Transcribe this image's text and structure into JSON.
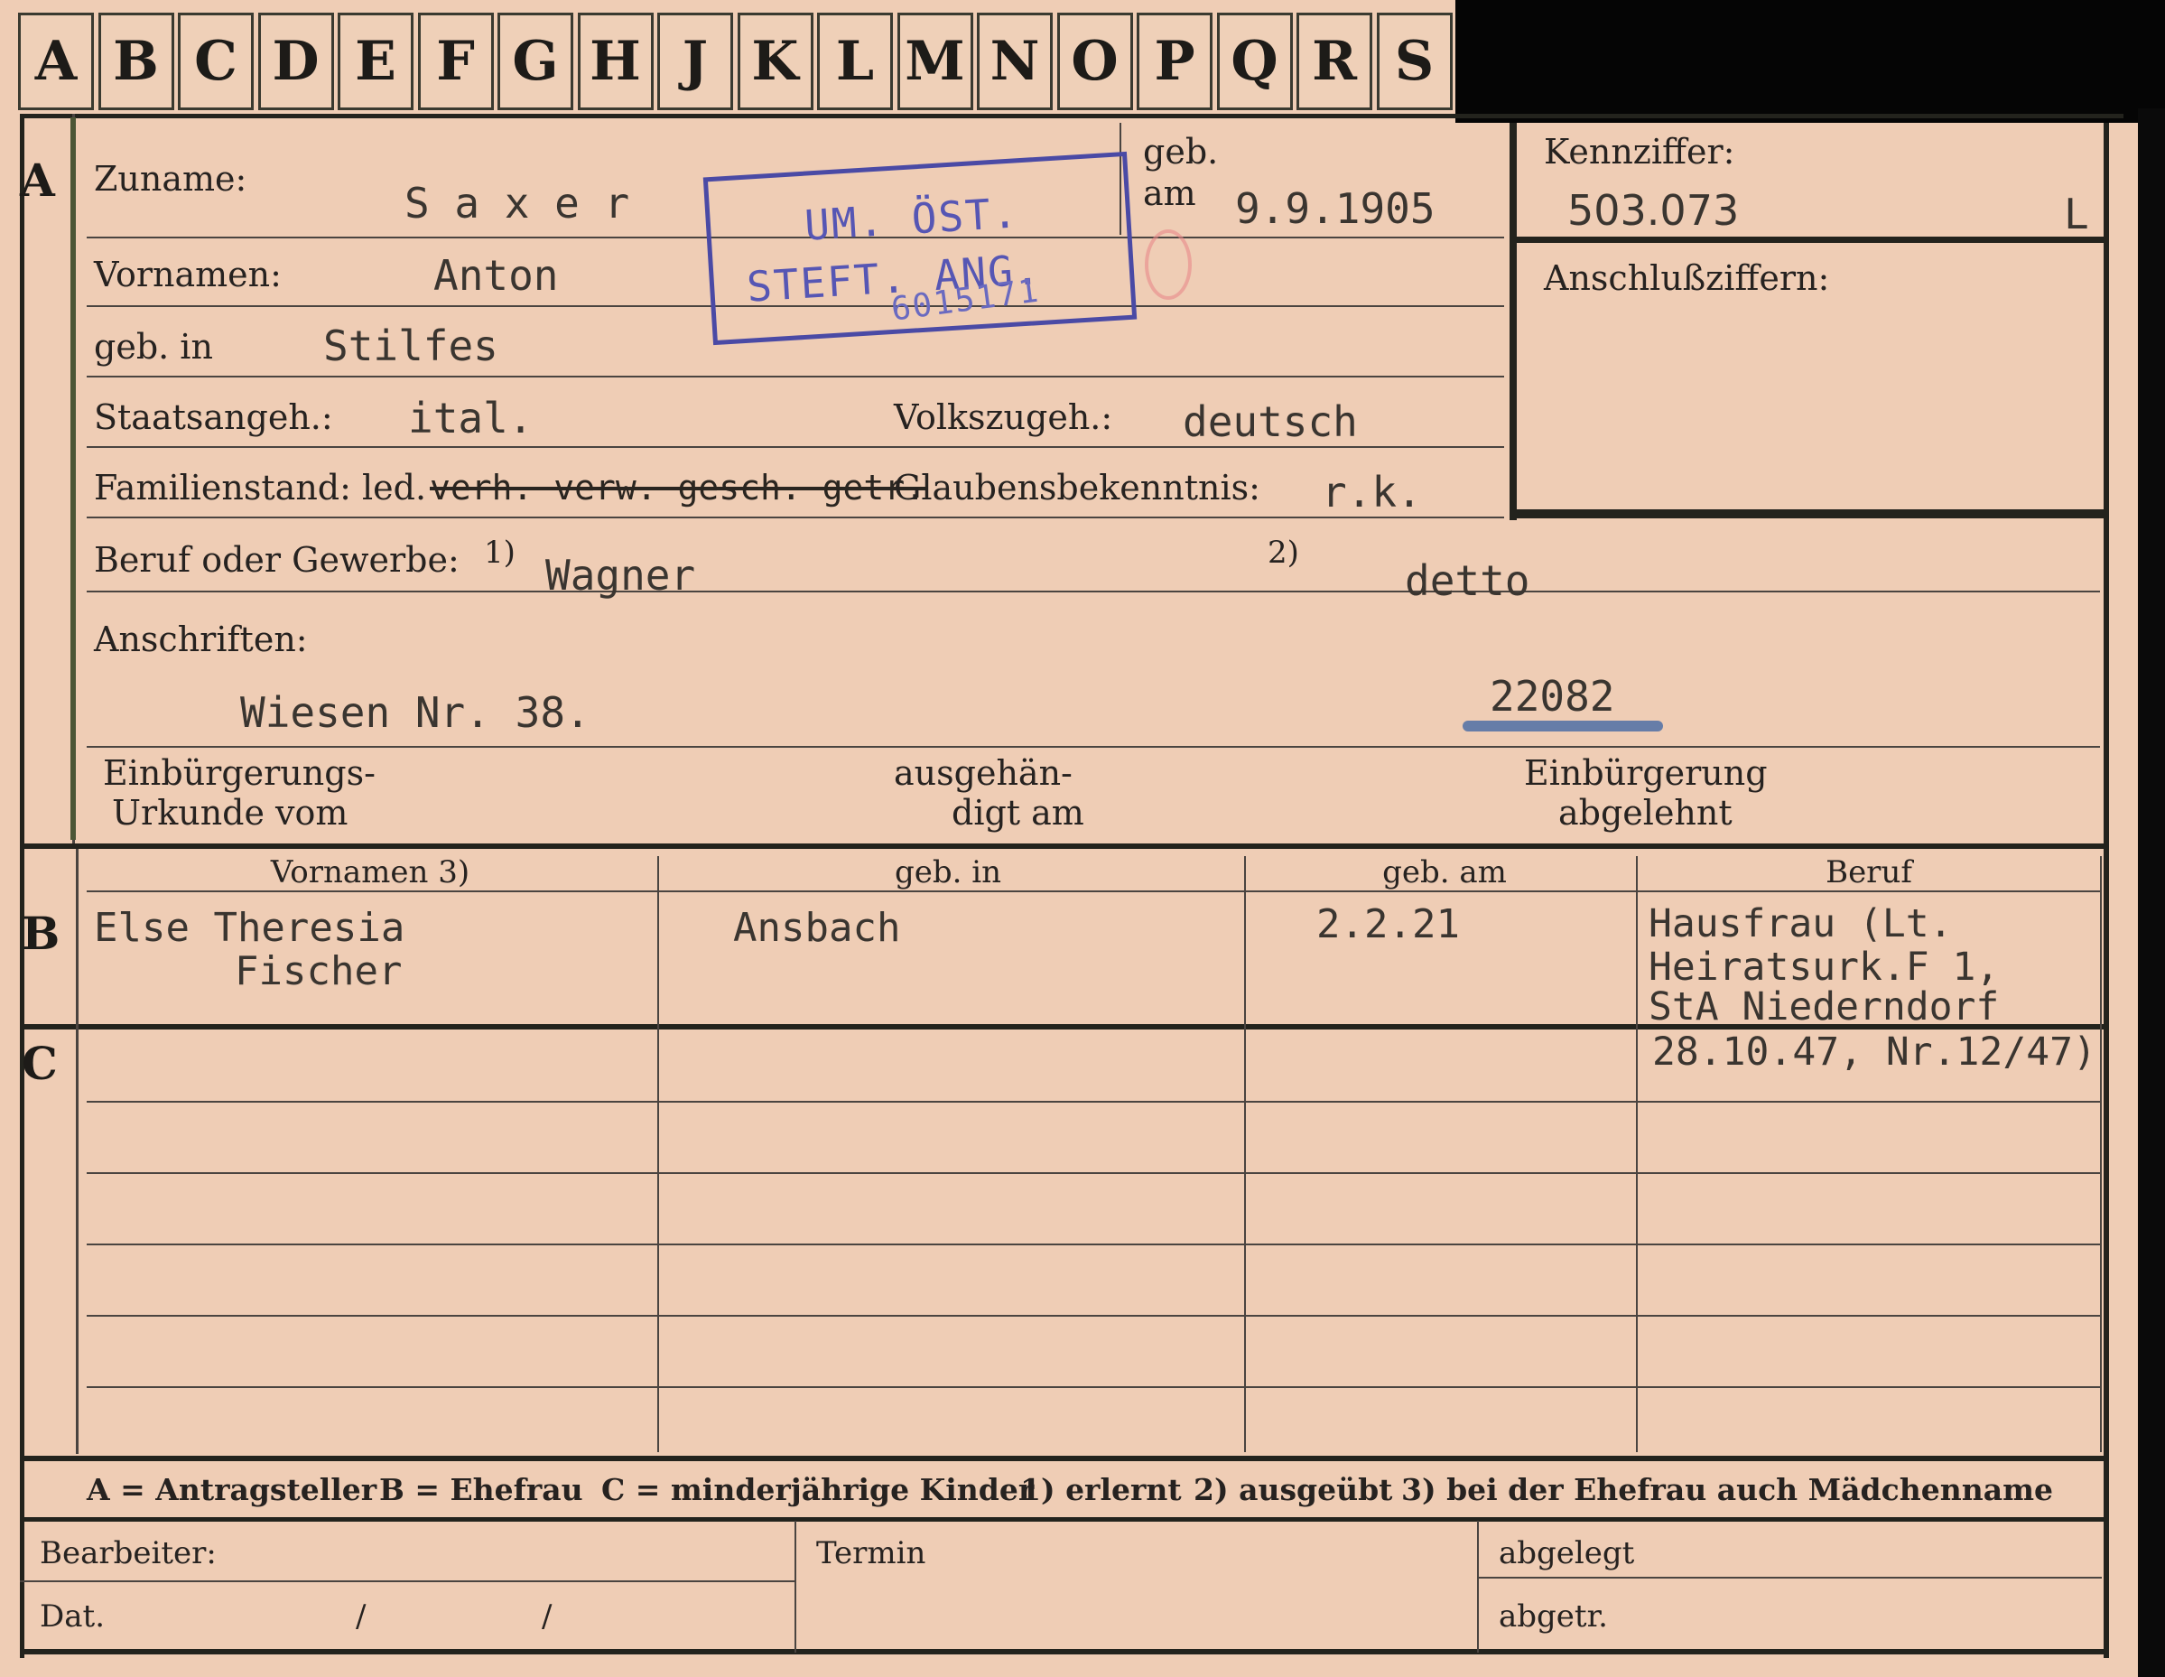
{
  "alphabet_tabs": [
    "A",
    "B",
    "C",
    "D",
    "E",
    "F",
    "G",
    "H",
    "J",
    "K",
    "L",
    "M",
    "N",
    "O",
    "P",
    "Q",
    "R",
    "S"
  ],
  "section_markers": {
    "a": "A",
    "b": "B",
    "c": "C"
  },
  "applicant": {
    "surname_label": "Zuname:",
    "surname_value": "S a x e r",
    "birthdate_label_1": "geb.",
    "birthdate_label_2": "am",
    "birthdate_value": "9.9.1905",
    "firstname_label": "Vornamen:",
    "firstname_value": "Anton",
    "birthplace_label": "geb. in",
    "birthplace_value": "Stilfes",
    "citizenship_label": "Staatsangeh.:",
    "citizenship_value": "ital.",
    "ethnicity_label": "Volkszugeh.:",
    "ethnicity_value": "deutsch",
    "marital_label": "Familienstand: led.",
    "marital_struck_value": "verh. verw. gesch. getr.",
    "religion_label": "Glaubensbekenntnis:",
    "religion_value": "r.k.",
    "profession_label": "Beruf oder Gewerbe:",
    "profession_mark_1": "1)",
    "profession_value_1": "Wagner",
    "profession_mark_2": "2)",
    "profession_value_2": "detto",
    "address_label": "Anschriften:",
    "address_value": "Wiesen Nr. 38.",
    "address_number": "22082",
    "naturalization_label_1": "Einbürgerungs-",
    "naturalization_label_2": "Urkunde vom",
    "handed_label_1": "ausgehän-",
    "handed_label_2": "digt am",
    "refused_label_1": "Einbürgerung",
    "refused_label_2": "abgelehnt"
  },
  "stamp": {
    "line1": "UM. ÖST.",
    "line2": "STEFT. ANG.",
    "handwritten": "6015171"
  },
  "id_box": {
    "kennziffer_label": "Kennziffer:",
    "kennziffer_value": "503.073",
    "kennziffer_suffix": "L",
    "anschluss_label": "Anschlußziffern:"
  },
  "table": {
    "headers": [
      "Vornamen 3)",
      "geb. in",
      "geb. am",
      "Beruf"
    ],
    "spouse": {
      "vornamen_1": "Else Theresia",
      "vornamen_2": "Fischer",
      "geb_in": "Ansbach",
      "geb_am": "2.2.21",
      "beruf_lines": [
        "Hausfrau (Lt.",
        "Heiratsurk.F 1,",
        "StA Niederndorf",
        "28.10.47, Nr.12/47)"
      ]
    }
  },
  "legend": {
    "a": "A = Antragsteller",
    "b": "B = Ehefrau",
    "c": "C = minderjährige Kinder",
    "n1": "1) erlernt",
    "n2": "2) ausgeübt",
    "n3": "3) bei der Ehefrau auch Mädchenname"
  },
  "footer": {
    "bearbeiter": "Bearbeiter:",
    "dat": "Dat.",
    "slash": "/",
    "termin": "Termin",
    "abgelegt": "abgelegt",
    "abgetr": "abgetr."
  }
}
